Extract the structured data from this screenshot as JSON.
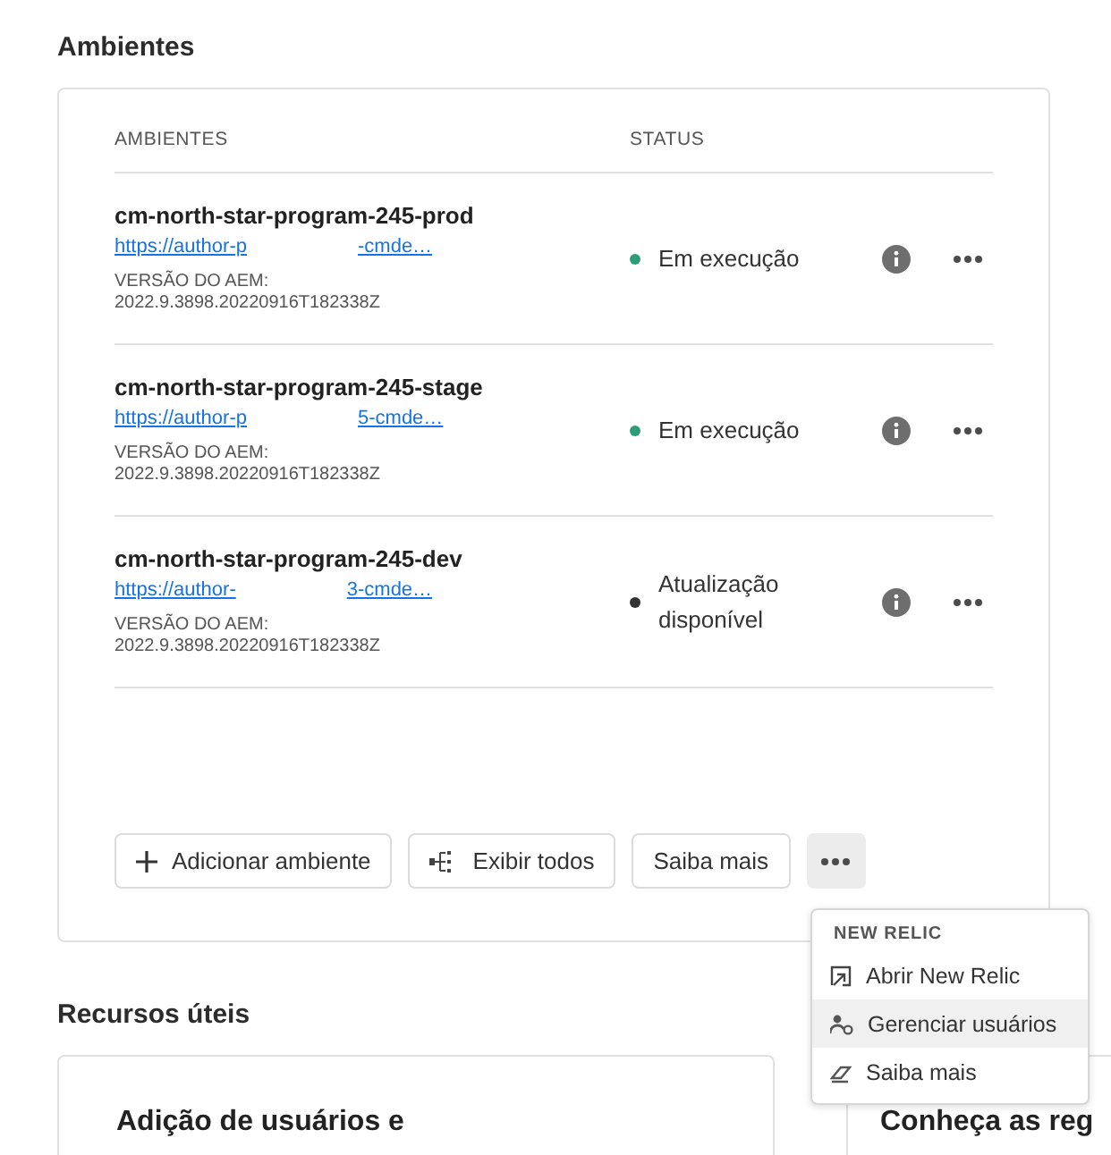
{
  "section_title": "Ambientes",
  "table": {
    "columns": [
      "AMBIENTES",
      "STATUS"
    ],
    "rows": [
      {
        "name": "cm-north-star-program-245-prod",
        "url_start": "https://author-p",
        "url_end": "-cmde…",
        "version_label": "VERSÃO DO AEM:",
        "version": "2022.9.3898.20220916T182338Z",
        "status": "Em execução",
        "color": "#2d9d78"
      },
      {
        "name": "cm-north-star-program-245-stage",
        "url_start": "https://author-p",
        "url_end": "5-cmde…",
        "version_label": "VERSÃO DO AEM:",
        "version": "2022.9.3898.20220916T182338Z",
        "status": "Em execução",
        "color": "#2d9d78"
      },
      {
        "name": "cm-north-star-program-245-dev",
        "url_start": "https://author-",
        "url_end": "3-cmde…",
        "version_label": "VERSÃO DO AEM:",
        "version": "2022.9.3898.20220916T182338Z",
        "status": "Atualização disponível",
        "color": "#323232"
      }
    ]
  },
  "actions": [
    {
      "kind": "add",
      "label": "Adicionar ambiente"
    },
    {
      "kind": "view",
      "label": "Exibir todos"
    },
    {
      "kind": "plain",
      "label": "Saiba mais"
    }
  ],
  "more_menu": {
    "open": true,
    "heading": "NEW RELIC",
    "items": [
      {
        "kind": "open",
        "label": "Abrir New Relic",
        "highlighted": false
      },
      {
        "kind": "users",
        "label": "Gerenciar usuários",
        "highlighted": true
      },
      {
        "kind": "learn",
        "label": "Saiba mais",
        "highlighted": false
      }
    ]
  },
  "resources": {
    "title": "Recursos úteis",
    "cards": [
      {
        "title": "Adição de usuários e"
      },
      {
        "title": "Conheça as reg"
      }
    ]
  }
}
